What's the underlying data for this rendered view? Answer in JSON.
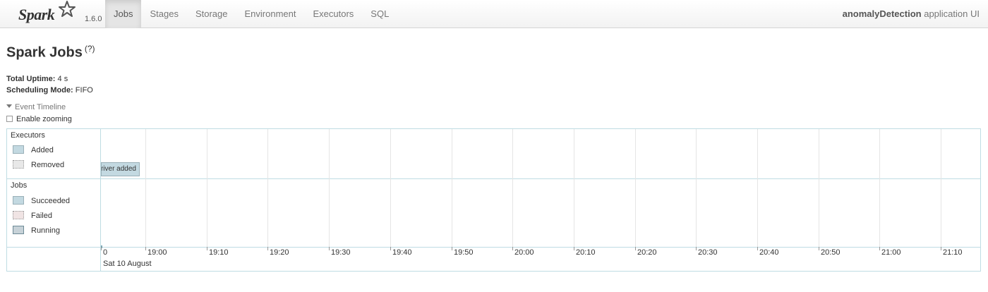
{
  "brand": {
    "name": "Spark",
    "version": "1.6.0",
    "star_color": "#555555"
  },
  "nav": {
    "tabs": [
      {
        "label": "Jobs",
        "active": true
      },
      {
        "label": "Stages",
        "active": false
      },
      {
        "label": "Storage",
        "active": false
      },
      {
        "label": "Environment",
        "active": false
      },
      {
        "label": "Executors",
        "active": false
      },
      {
        "label": "SQL",
        "active": false
      }
    ],
    "app_name": "anomalyDetection",
    "app_suffix": "application UI"
  },
  "page": {
    "title": "Spark Jobs",
    "help": "(?)",
    "uptime_label": "Total Uptime:",
    "uptime_value": "4 s",
    "mode_label": "Scheduling Mode:",
    "mode_value": "FIFO"
  },
  "timeline": {
    "toggle_label": "Event Timeline",
    "zoom_label": "Enable zooming",
    "zoom_enabled": false,
    "executors": {
      "title": "Executors",
      "legend": [
        "Added",
        "Removed"
      ],
      "event_text": "Driver added"
    },
    "jobs": {
      "title": "Jobs",
      "legend": [
        "Succeeded",
        "Failed",
        "Running"
      ]
    },
    "axis": {
      "ticks": [
        "0",
        "19:00",
        "19:10",
        "19:20",
        "19:30",
        "19:40",
        "19:50",
        "20:00",
        "20:10",
        "20:20",
        "20:30",
        "20:40",
        "20:50",
        "21:00",
        "21:10"
      ],
      "date": "Sat 10 August"
    },
    "colors": {
      "border": "#bfdce3",
      "added": "#c3d9e1",
      "running": "#c7d2d8"
    }
  }
}
